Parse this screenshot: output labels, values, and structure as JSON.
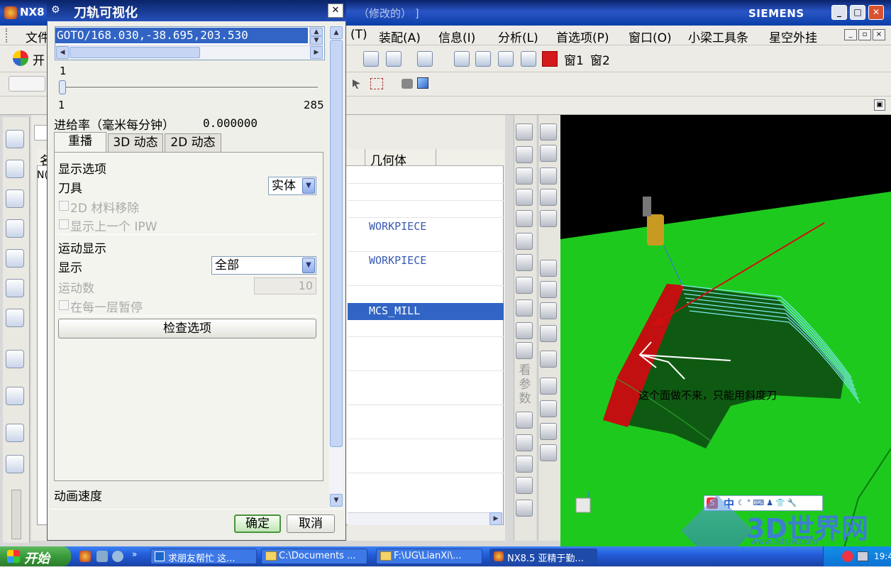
{
  "app": {
    "title": "NX8",
    "title_suffix": "（修改的） ]",
    "brand": "SIEMENS"
  },
  "window_buttons": {
    "minimize": "_",
    "maximize": "□",
    "close": "✕"
  },
  "menubar": {
    "items": [
      {
        "label": "文件"
      },
      {
        "label": "(T)"
      },
      {
        "label": "装配(A)"
      },
      {
        "label": "信息(I)"
      },
      {
        "label": "分析(L)"
      },
      {
        "label": "首选项(P)"
      },
      {
        "label": "窗口(O)"
      },
      {
        "label": "小梁工具条"
      },
      {
        "label": "星空外挂"
      }
    ]
  },
  "toolbar": {
    "start_label": "开",
    "window1_label": "窗1",
    "window2_label": "窗2"
  },
  "navigator": {
    "geometry_header": "几何体",
    "rows": [
      {
        "geometry": "WORKPIECE"
      },
      {
        "geometry": "WORKPIECE"
      },
      {
        "geometry": "MCS_MILL"
      }
    ],
    "tab_partial": "名",
    "row_partial": "N("
  },
  "side_toolbar": {
    "vertical_text": "看参数"
  },
  "viewport": {
    "annotation": "这个面做不来，只能用斜度刀",
    "ime_label": "中",
    "watermark_logo": "3D世界网",
    "watermark_url": "www.3dsjw.com",
    "colors": {
      "part": "#1ec91e",
      "background": "#000000",
      "arrow": "#d01010",
      "toolpath": "#7de8f0"
    }
  },
  "dialog": {
    "title": "刀轨可视化",
    "listbox_selected": "GOTO/168.030,-38.695,203.530",
    "slider": {
      "current_label": "1",
      "min_label": "1",
      "max_label": "285",
      "value": 1,
      "min": 1,
      "max": 285
    },
    "feedrate_label": "进给率（毫米每分钟）",
    "feedrate_value": "0.000000",
    "tabs": [
      {
        "label": "重播",
        "active": true
      },
      {
        "label": "3D 动态",
        "active": false
      },
      {
        "label": "2D 动态",
        "active": false
      }
    ],
    "display_options_label": "显示选项",
    "tool_label": "刀具",
    "tool_value": "实体",
    "material_removal_label": "2D 材料移除",
    "show_prev_ipw_label": "显示上一个 IPW",
    "motion_display_label": "运动显示",
    "display_label": "显示",
    "display_value": "全部",
    "motion_count_label": "运动数",
    "motion_count_value": "10",
    "pause_each_layer_label": "在每一层暂停",
    "check_options_label": "检查选项",
    "anim_speed_label": "动画速度",
    "ok_label": "确定",
    "cancel_label": "取消"
  },
  "taskbar": {
    "start_label": "开始",
    "tasks": [
      {
        "label": "求朋友帮忙 这..."
      },
      {
        "label": "C:\\Documents ..."
      },
      {
        "label": "F:\\UG\\LianXi\\..."
      },
      {
        "label": "NX8.5 亚精于勤..."
      }
    ],
    "clock": "19:4"
  }
}
